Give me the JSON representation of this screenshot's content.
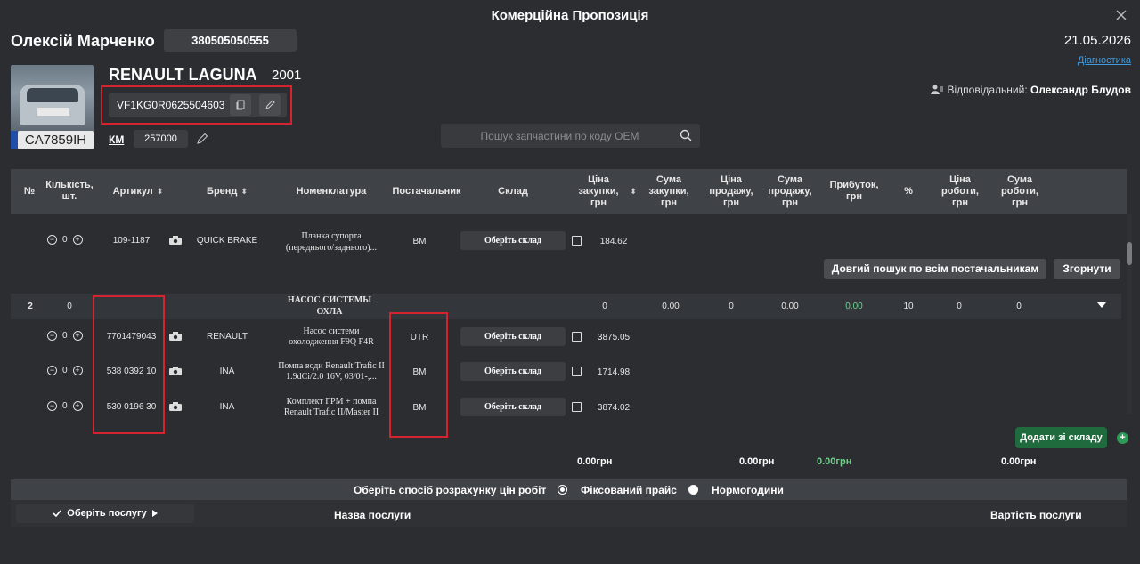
{
  "window": {
    "title": "Комерційна Пропозиція"
  },
  "customer": {
    "name": "Олексій Марченко",
    "phone": "380505050555"
  },
  "date": "21.05.2026",
  "diagnostics_link": "Діагностика",
  "responsible": {
    "label": "Відповідальний:",
    "name": "Олександр Блудов"
  },
  "car": {
    "model": "RENAULT LAGUNA",
    "year": "2001",
    "vin": "VF1KG0R0625504603",
    "plate": "CA7859IH",
    "km_label": "КМ",
    "km": "257000"
  },
  "search": {
    "placeholder": "Пошук запчастини по коду OEM"
  },
  "table": {
    "headers": {
      "num": "№",
      "qty": "Кількість, шт.",
      "article": "Артикул",
      "brand": "Бренд",
      "nomenclature": "Номенклатура",
      "supplier": "Постачальник",
      "warehouse": "Склад",
      "purchase_price": "Ціна закупки, грн",
      "purchase_sum": "Сума закупки, грн",
      "sale_price": "Ціна продажу, грн",
      "sale_sum": "Сума продажу, грн",
      "profit": "Прибуток, грн",
      "percent": "%",
      "work_price": "Ціна роботи, грн",
      "work_sum": "Сума роботи, грн"
    },
    "first_item": {
      "qty": "0",
      "article": "109-1187",
      "brand": "QUICK BRAKE",
      "nomenclature": "Планка супорта (переднього/заднього)...",
      "supplier": "BM",
      "warehouse_btn": "Оберіть склад",
      "price": "184.62"
    },
    "long_search_btn": "Довгий пошук по всім постачальникам",
    "collapse_btn": "Згорнути",
    "group": {
      "num": "2",
      "qty": "0",
      "name": "НАСОС СИСТЕМЫ ОХЛА",
      "purchase_price": "0",
      "purchase_sum": "0.00",
      "sale_price": "0",
      "sale_sum": "0.00",
      "profit": "0.00",
      "percent": "10",
      "work_price": "0",
      "work_sum": "0"
    },
    "items": [
      {
        "qty": "0",
        "article": "7701479043",
        "brand": "RENAULT",
        "nomenclature": "Насос системи охолодження F9Q F4R",
        "supplier": "UTR",
        "warehouse_btn": "Оберіть склад",
        "price": "3875.05"
      },
      {
        "qty": "0",
        "article": "538 0392 10",
        "brand": "INA",
        "nomenclature": "Помпа води Renault Trafic II 1.9dCi/2.0 16V, 03/01-,...",
        "supplier": "BM",
        "warehouse_btn": "Оберіть склад",
        "price": "1714.98"
      },
      {
        "qty": "0",
        "article": "530 0196 30",
        "brand": "INA",
        "nomenclature": "Комплект ГРМ + помпа Renault Trafic II/Master II",
        "supplier": "BM",
        "warehouse_btn": "Оберіть склад",
        "price": "3874.02"
      }
    ]
  },
  "add_from_warehouse_btn": "Додати зі складу",
  "totals": {
    "purchase": "0.00грн",
    "sale": "0.00грн",
    "profit": "0.00грн",
    "work": "0.00грн"
  },
  "work_calc": {
    "label": "Оберіть спосіб розрахунку цін робіт",
    "option_fixed": "Фіксований прайс",
    "option_norm": "Нормогодини"
  },
  "services": {
    "select_btn": "Оберіть послугу",
    "name_header": "Назва послуги",
    "cost_header": "Вартість послуги"
  },
  "colors": {
    "background": "#2b2d30",
    "header": "#3f4246",
    "accent_green": "#1f6b3e",
    "highlight_red": "#d5232f",
    "profit_green": "#6fd08c",
    "link": "#3f9be0"
  }
}
